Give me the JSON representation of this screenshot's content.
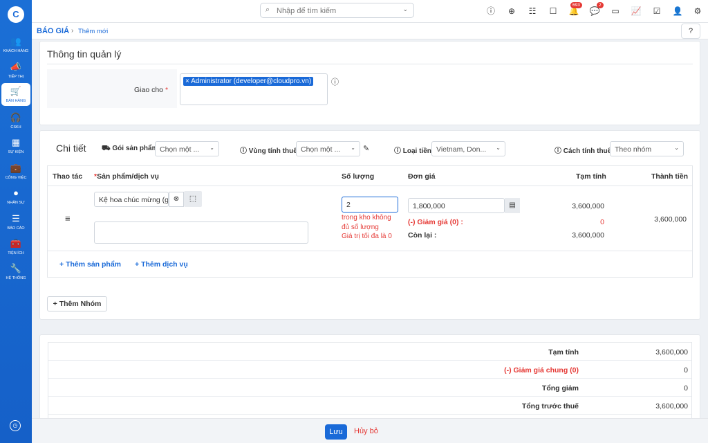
{
  "sidebar": {
    "logo": "C",
    "items": [
      {
        "label": "KHÁCH HÀNG",
        "icon": "users-icon"
      },
      {
        "label": "TIẾP THỊ",
        "icon": "megaphone-icon"
      },
      {
        "label": "BÁN HÀNG",
        "icon": "cart-icon"
      },
      {
        "label": "CSKH",
        "icon": "headset-icon"
      },
      {
        "label": "SỰ KIỆN",
        "icon": "calendar-icon"
      },
      {
        "label": "CÔNG VIỆC",
        "icon": "briefcase-icon"
      },
      {
        "label": "NHÂN SỰ",
        "icon": "person-icon"
      },
      {
        "label": "BÁO CÁO",
        "icon": "report-icon"
      },
      {
        "label": "TIỆN ÍCH",
        "icon": "toolbox-icon"
      },
      {
        "label": "HỆ THỐNG",
        "icon": "wrench-icon"
      }
    ]
  },
  "topbar": {
    "search_placeholder": "Nhập để tìm kiếm",
    "notif_count": "693",
    "chat_count": "2"
  },
  "breadcrumb": {
    "module": "BÁO GIÁ",
    "page": "Thêm mới"
  },
  "mgmt": {
    "title": "Thông tin quản lý",
    "assign_label": "Giao cho",
    "assign_tag": "Administrator (developer@cloudpro.vn)"
  },
  "detail": {
    "title": "Chi tiết",
    "package_label": "Gói sản phẩm",
    "package_value": "Chọn một ...",
    "tax_label": "Vùng tính thuế",
    "tax_value": "Chọn một ...",
    "currency_label": "Loại tiền",
    "currency_value": "Vietnam, Don...",
    "calc_label": "Cách tính thuế",
    "calc_value": "Theo nhóm"
  },
  "table": {
    "headers": {
      "action": "Thao tác",
      "product": "Sản phẩm/dịch vụ",
      "qty": "Số lượng",
      "price": "Đơn giá",
      "subtotal": "Tạm tính",
      "total": "Thành tiền"
    },
    "row": {
      "product": "Kệ hoa chúc mừng (gỗ",
      "qty": "2",
      "stock_warn1": "trong kho không",
      "stock_warn2": "đủ số lượng",
      "max_warn": "Giá trị tối đa là 0",
      "price": "1,800,000",
      "discount_label": "(-) Giảm giá (0) :",
      "remain_label": "Còn lại :",
      "subtotal": "3,600,000",
      "discount_value": "0",
      "remain_value": "3,600,000",
      "total": "3,600,000"
    },
    "add_product": "Thêm sản phẩm",
    "add_service": "Thêm dịch vụ",
    "add_group": "Thêm Nhóm"
  },
  "summary": [
    {
      "label": "Tạm tính",
      "value": "3,600,000",
      "red": false
    },
    {
      "label": "(-) Giảm giá chung (0)",
      "value": "0",
      "red": true
    },
    {
      "label": "Tổng giảm",
      "value": "0",
      "red": false
    },
    {
      "label": "Tổng trước thuế",
      "value": "3,600,000",
      "red": false
    }
  ],
  "footer": {
    "save": "Lưu",
    "cancel": "Hủy bỏ"
  }
}
